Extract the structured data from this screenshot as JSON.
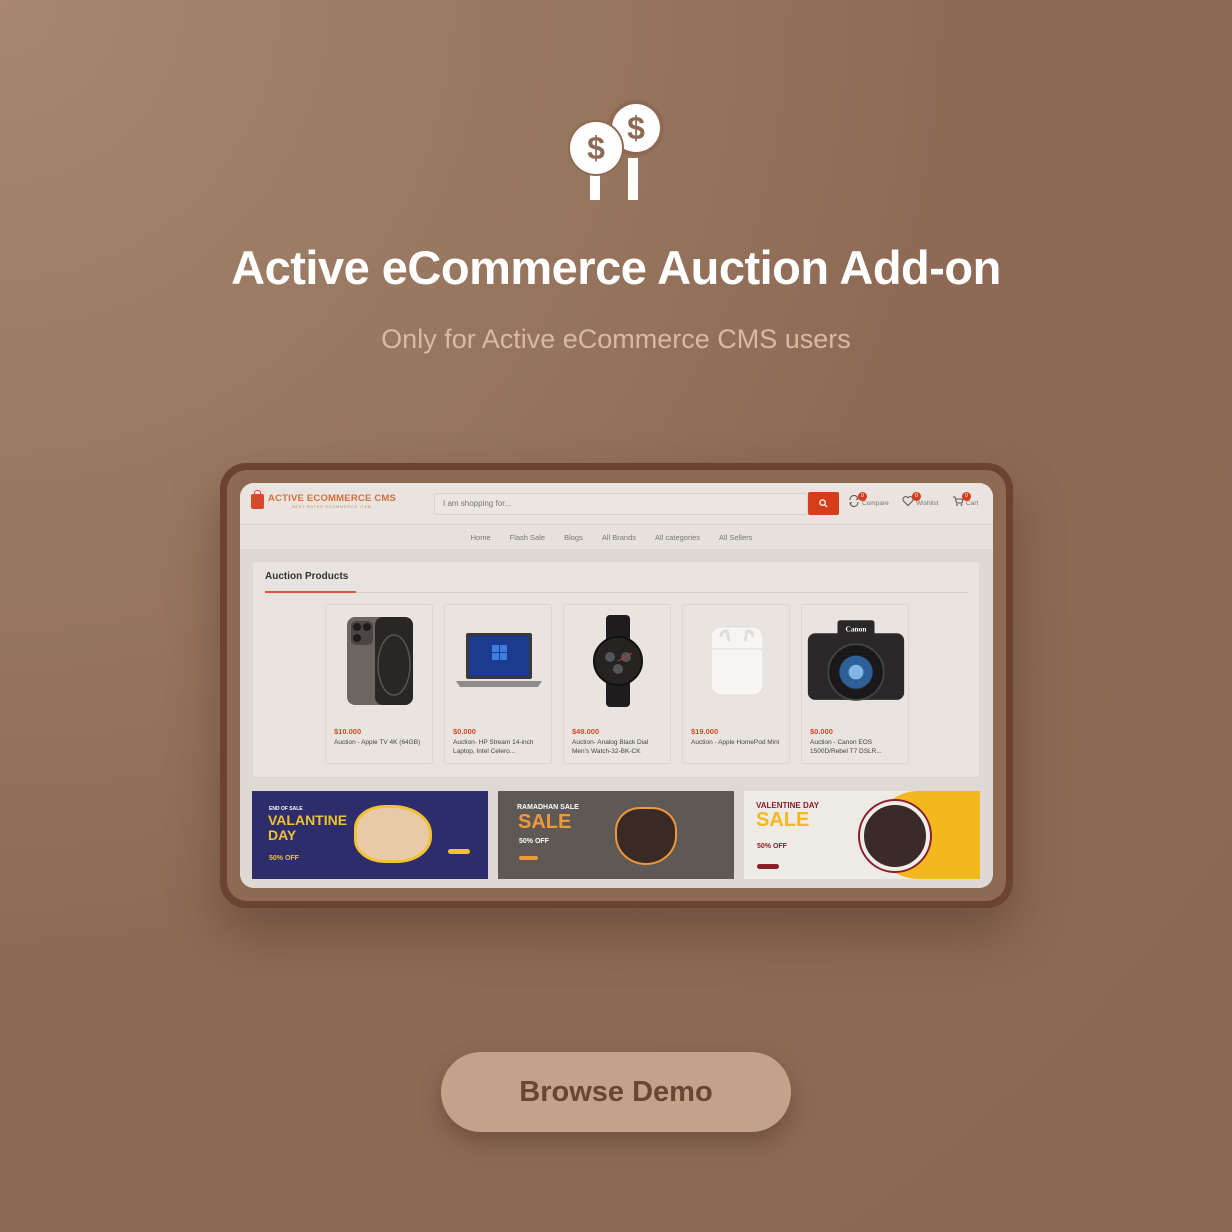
{
  "hero": {
    "icon": "auction-money-icon",
    "title": "Active eCommerce Auction Add-on",
    "subtitle": "Only for Active eCommerce CMS users"
  },
  "colors": {
    "background": "#8e6a55",
    "frame": "#6a4331",
    "accent": "#d63d1a",
    "button_bg": "#c4a28a",
    "button_text": "#6b4433"
  },
  "screen": {
    "logo": {
      "main": "ACTIVE ECOMMERCE CMS",
      "tagline": "BEST RATED ECOMMERCE ITEM"
    },
    "search": {
      "placeholder": "I am shopping for..."
    },
    "toolbar": [
      {
        "icon": "compare-icon",
        "label": "Compare",
        "count": "0"
      },
      {
        "icon": "heart-icon",
        "label": "Wishlist",
        "count": "0"
      },
      {
        "icon": "cart-icon",
        "label": "Cart",
        "count": "0"
      }
    ],
    "nav": [
      "Home",
      "Flash Sale",
      "Blogs",
      "All Brands",
      "All categories",
      "All Sellers"
    ],
    "section_title": "Auction Products",
    "products": [
      {
        "image": "iphone",
        "price": "$10.000",
        "name": "Auction - Apple TV 4K (64GB)"
      },
      {
        "image": "laptop",
        "price": "$0.000",
        "name": "Auction- HP Stream 14-inch Laptop, Intel Celero..."
      },
      {
        "image": "watch",
        "price": "$49.000",
        "name": "Auction- Analog Black Dial Men's Watch-32-BK-CK"
      },
      {
        "image": "airpods",
        "price": "$19.000",
        "name": "Auction - Apple HomePod Mini"
      },
      {
        "image": "camera",
        "price": "$0.000",
        "name": "Auction - Canon EOS 1500D/Rebel T7 DSLR..."
      }
    ],
    "banners": [
      {
        "kicker": "END OF SALE",
        "headline_1": "VALANTINE",
        "headline_2": "DAY",
        "offer": "50% OFF"
      },
      {
        "kicker": "RAMADHAN SALE",
        "headline_1": "SALE",
        "headline_2": "",
        "offer": "50% OFF"
      },
      {
        "kicker": "VALENTINE DAY",
        "headline_1": "SALE",
        "headline_2": "",
        "offer": "50% OFF"
      }
    ]
  },
  "cta": {
    "label": "Browse Demo"
  }
}
